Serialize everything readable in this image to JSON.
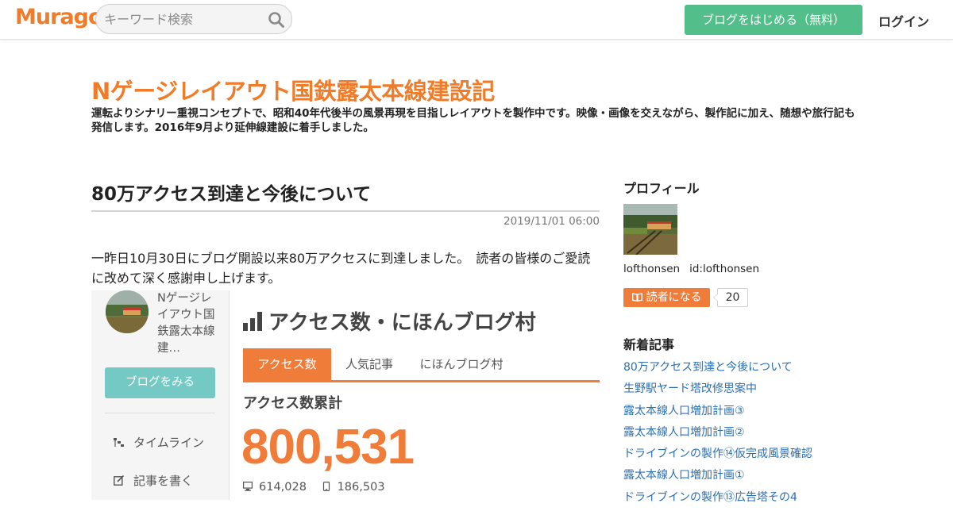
{
  "topbar": {
    "logo": "Muragon",
    "search_placeholder": "キーワード検索",
    "start_blog_label": "ブログをはじめる（無料）",
    "login_label": "ログイン"
  },
  "header": {
    "blog_title": "Nゲージレイアウト国鉄露太本線建設記",
    "description": "運転よりシナリー重視コンセプトで、昭和40年代後半の風景再現を目指しレイアウトを製作中です。映像・画像を交えながら、製作記に加え、随想や旅行記も発信します。2016年9月より延伸線建設に着手しました。"
  },
  "article": {
    "title": "80万アクセス到達と今後について",
    "date": "2019/11/01 06:00",
    "body": "一昨日10月30日にブログ開設以来80万アクセスに到達しました。　読者の皆様のご愛読に改めて深く感謝申し上げます。"
  },
  "embed": {
    "blog_name": "Nゲージレイアウト国鉄露太本線建…",
    "view_blog_label": "ブログをみる",
    "menu": [
      {
        "icon": "timeline-icon",
        "label": "タイムライン"
      },
      {
        "icon": "write-icon",
        "label": "記事を書く"
      }
    ],
    "heading": "アクセス数・にほんブログ村",
    "tabs": [
      "アクセス数",
      "人気記事",
      "にほんブログ村"
    ],
    "active_tab": "アクセス数",
    "subheading": "アクセス数累計",
    "total": "800,531",
    "pc_count": "614,028",
    "mobile_count": "186,503"
  },
  "sidebar": {
    "profile_heading": "プロフィール",
    "username": "lofthonsen",
    "user_id": "id:lofthonsen",
    "reader_button_label": "読者になる",
    "reader_count": "20",
    "recent_heading": "新着記事",
    "recent_posts": [
      "80万アクセス到達と今後について",
      "生野駅ヤード塔改修思案中",
      "露太本線人口増加計画③",
      "露太本線人口増加計画②",
      "ドライブインの製作⑭仮完成風景確認",
      "露太本線人口増加計画①",
      "ドライブインの製作⑬広告塔その4"
    ]
  },
  "colors": {
    "accent_orange": "#f07c2a",
    "green_button": "#52bf8a",
    "teal_button": "#75c9c5",
    "link_blue": "#2a6fb4"
  }
}
